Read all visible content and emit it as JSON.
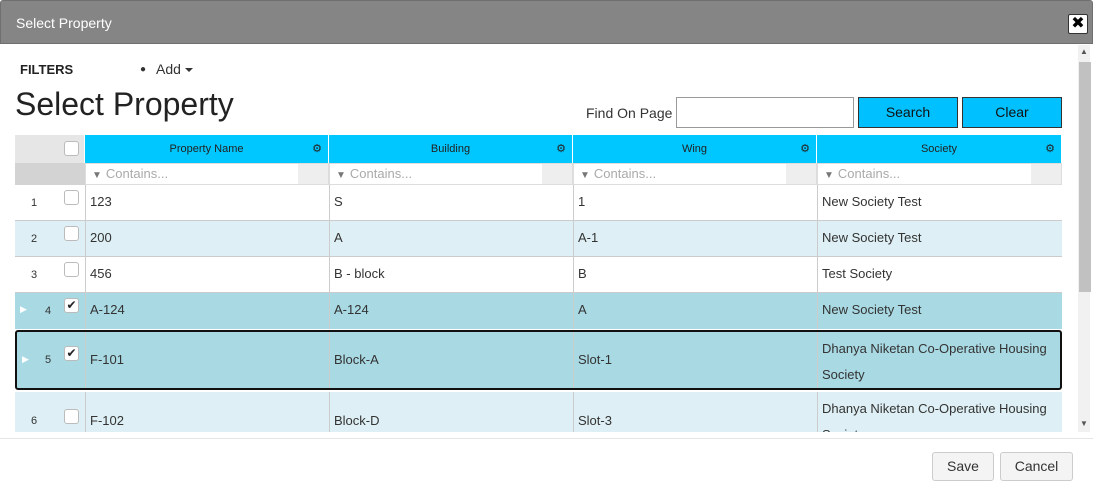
{
  "dialog": {
    "title": "Select Property",
    "close_glyph": "✖"
  },
  "filters": {
    "label": "FILTERS",
    "add_label": "Add"
  },
  "page_title": "Select Property",
  "find": {
    "label": "Find On Page",
    "value": "",
    "search_label": "Search",
    "clear_label": "Clear"
  },
  "grid": {
    "columns": [
      "Property Name",
      "Building",
      "Wing",
      "Society"
    ],
    "filter_placeholder": "Contains...",
    "rows": [
      {
        "index": "1",
        "checked": false,
        "property": "123",
        "building": "S",
        "wing": "1",
        "society": "New Society Test"
      },
      {
        "index": "2",
        "checked": false,
        "property": "200",
        "building": "A",
        "wing": "A-1",
        "society": "New Society Test"
      },
      {
        "index": "3",
        "checked": false,
        "property": "456",
        "building": "B - block",
        "wing": "B",
        "society": "Test Society"
      },
      {
        "index": "4",
        "checked": true,
        "property": "A-124",
        "building": "A-124",
        "wing": "A",
        "society": "New Society Test"
      },
      {
        "index": "5",
        "checked": true,
        "property": "F-101",
        "building": "Block-A",
        "wing": "Slot-1",
        "society_line1": "Dhanya Niketan Co-Operative Housing",
        "society_line2": "Society"
      },
      {
        "index": "6",
        "checked": false,
        "property": "F-102",
        "building": "Block-D",
        "wing": "Slot-3",
        "society_line1": "Dhanya Niketan Co-Operative Housing",
        "society_line2": "Society"
      }
    ]
  },
  "footer": {
    "save_label": "Save",
    "cancel_label": "Cancel"
  },
  "colors": {
    "titlebar": "#858585",
    "accent": "#00c7ff",
    "selected_row": "#a9d9e3",
    "alt_row": "#def0f5"
  }
}
